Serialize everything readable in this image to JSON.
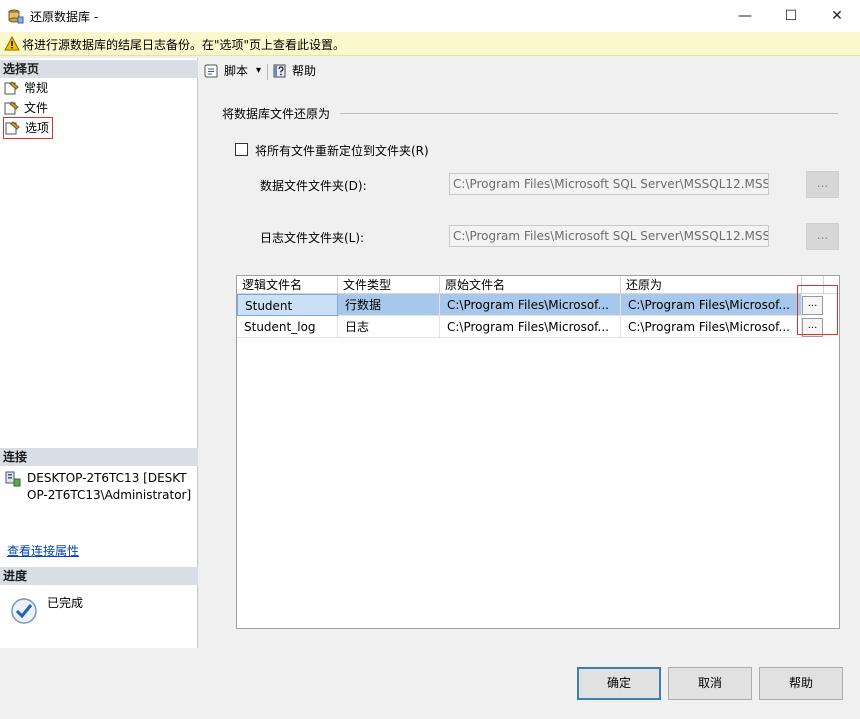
{
  "window": {
    "title": "还原数据库 -",
    "minimize_glyph": "—",
    "maximize_glyph": "☐",
    "close_glyph": "✕"
  },
  "warning": {
    "text": "将进行源数据库的结尾日志备份。在\"选项\"页上查看此设置。",
    "icon": "warning-icon"
  },
  "left_pane": {
    "select_page_header": "选择页",
    "pages": [
      {
        "label": "常规",
        "icon": "page-wrench-icon"
      },
      {
        "label": "文件",
        "icon": "page-wrench-icon"
      },
      {
        "label": "选项",
        "icon": "page-wrench-icon",
        "selected": true
      }
    ],
    "connection_header": "连接",
    "connection_text": "DESKTOP-2T6TC13 [DESKTOP-2T6TC13\\Administrator]",
    "connection_link": "查看连接属性",
    "progress_header": "进度",
    "progress_status": "已完成"
  },
  "toolbar": {
    "script_label": "脚本",
    "script_dropdown_glyph": "▾",
    "help_label": "帮助"
  },
  "restore_files": {
    "group_title": "将数据库文件还原为",
    "relocate_checkbox_label": "将所有文件重新定位到文件夹(R)",
    "relocate_checked": false,
    "data_folder_label": "数据文件文件夹(D):",
    "data_folder_value": "C:\\Program Files\\Microsoft SQL Server\\MSSQL12.MSS",
    "log_folder_label": "日志文件文件夹(L):",
    "log_folder_value": "C:\\Program Files\\Microsoft SQL Server\\MSSQL12.MSS",
    "browse_glyph": "..."
  },
  "files_grid": {
    "columns": [
      "逻辑文件名",
      "文件类型",
      "原始文件名",
      "还原为"
    ],
    "rows": [
      {
        "logical": "Student",
        "type": "行数据",
        "original": "C:\\Program Files\\Microsof...",
        "restore_as": "C:\\Program Files\\Microsof...",
        "selected": true
      },
      {
        "logical": "Student_log",
        "type": "日志",
        "original": "C:\\Program Files\\Microsof...",
        "restore_as": "C:\\Program Files\\Microsof...",
        "selected": false
      }
    ],
    "row_browse_glyph": "..."
  },
  "buttons": {
    "ok": "确定",
    "cancel": "取消",
    "help": "帮助"
  }
}
